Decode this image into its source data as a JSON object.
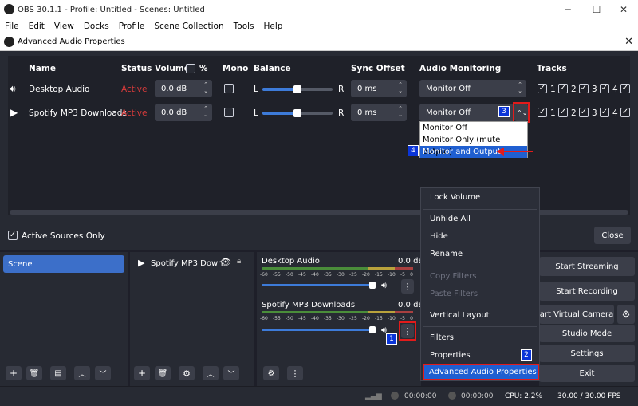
{
  "app": {
    "title": "OBS 30.1.1 - Profile: Untitled - Scenes: Untitled"
  },
  "menu": [
    "File",
    "Edit",
    "View",
    "Docks",
    "Profile",
    "Scene Collection",
    "Tools",
    "Help"
  ],
  "dialog": {
    "title": "Advanced Audio Properties",
    "columns": {
      "name": "Name",
      "status": "Status",
      "volume": "Volume",
      "percent": "%",
      "mono": "Mono",
      "balance": "Balance",
      "sync": "Sync Offset",
      "monitoring": "Audio Monitoring",
      "tracks": "Tracks"
    },
    "rows": [
      {
        "name": "Desktop Audio",
        "status": "Active",
        "volume": "0.0 dB",
        "balance_left": "L",
        "balance_right": "R",
        "balance_level": 0.5,
        "sync": "0 ms",
        "monitoring": "Monitor Off",
        "tracks": [
          "1",
          "2",
          "3",
          "4"
        ]
      },
      {
        "name": "Spotify MP3 Downloads",
        "status": "Active",
        "volume": "0.0 dB",
        "balance_left": "L",
        "balance_right": "R",
        "balance_level": 0.5,
        "sync": "0 ms",
        "monitoring": "Monitor Off",
        "tracks": [
          "1",
          "2",
          "3",
          "4"
        ]
      }
    ],
    "monitor_options": [
      "Monitor Off",
      "Monitor Only (mute output)",
      "Monitor and Output"
    ],
    "active_only_label": "Active Sources Only",
    "close_label": "Close"
  },
  "badges": {
    "b1": "1",
    "b2": "2",
    "b3": "3",
    "b4": "4"
  },
  "scenes": {
    "items": [
      "Scene"
    ]
  },
  "sources": {
    "items": [
      "Spotify MP3 Down"
    ]
  },
  "mixer": {
    "channels": [
      {
        "name": "Desktop Audio",
        "db": "0.0 dB"
      },
      {
        "name": "Spotify MP3 Downloads",
        "db": "0.0 dB"
      }
    ],
    "scale": [
      "-60",
      "-55",
      "-50",
      "-45",
      "-40",
      "-35",
      "-30",
      "-25",
      "-20",
      "-15",
      "-10",
      "-5",
      "0"
    ]
  },
  "context_menu": {
    "items": [
      "Lock Volume",
      "Unhide All",
      "Hide",
      "Rename",
      "Copy Filters",
      "Paste Filters",
      "Vertical Layout",
      "Filters",
      "Properties",
      "Advanced Audio Properties"
    ]
  },
  "controls": {
    "start_streaming": "Start Streaming",
    "start_recording": "Start Recording",
    "start_virtual_camera": "art Virtual Camera",
    "studio_mode": "Studio Mode",
    "settings": "Settings",
    "exit": "Exit"
  },
  "status": {
    "stream_time": "00:00:00",
    "rec_time": "00:00:00",
    "cpu": "CPU: 2.2%",
    "fps": "30.00 / 30.00 FPS"
  },
  "colors": {
    "accent": "#1f5fd1",
    "active": "#d93b3b",
    "annotation": "#e21b1b",
    "badge": "#0b35d8"
  }
}
